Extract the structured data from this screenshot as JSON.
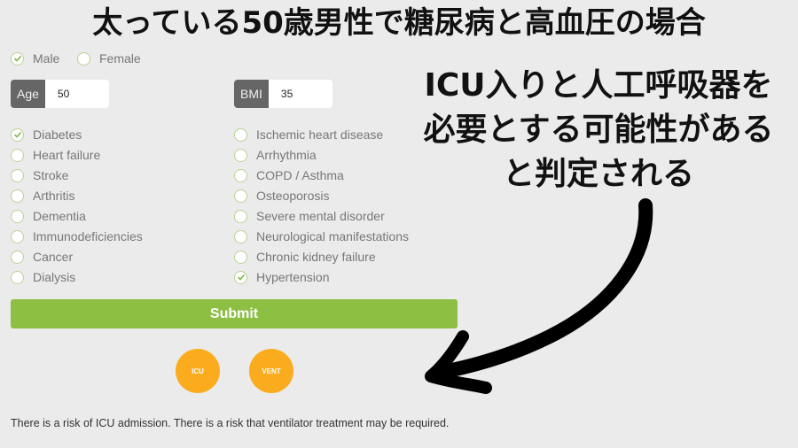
{
  "headline": "太っている50歳男性で糖尿病と高血圧の場合",
  "annotation": {
    "lines": [
      "ICU入りと人工呼吸器を",
      "必要とする可能性がある",
      "と判定される"
    ]
  },
  "sex": {
    "options": [
      {
        "label": "Male",
        "checked": true
      },
      {
        "label": "Female",
        "checked": false
      }
    ]
  },
  "age": {
    "label": "Age",
    "value": "50"
  },
  "bmi": {
    "label": "BMI",
    "value": "35"
  },
  "conditions_left": [
    {
      "label": "Diabetes",
      "checked": true
    },
    {
      "label": "Heart failure",
      "checked": false
    },
    {
      "label": "Stroke",
      "checked": false
    },
    {
      "label": "Arthritis",
      "checked": false
    },
    {
      "label": "Dementia",
      "checked": false
    },
    {
      "label": "Immunodeficiencies",
      "checked": false
    },
    {
      "label": "Cancer",
      "checked": false
    },
    {
      "label": "Dialysis",
      "checked": false
    }
  ],
  "conditions_right": [
    {
      "label": "Ischemic heart disease",
      "checked": false
    },
    {
      "label": "Arrhythmia",
      "checked": false
    },
    {
      "label": "COPD / Asthma",
      "checked": false
    },
    {
      "label": "Osteoporosis",
      "checked": false
    },
    {
      "label": "Severe mental disorder",
      "checked": false
    },
    {
      "label": "Neurological manifestations",
      "checked": false
    },
    {
      "label": "Chronic kidney failure",
      "checked": false
    },
    {
      "label": "Hypertension",
      "checked": true
    }
  ],
  "submit_label": "Submit",
  "badges": [
    {
      "label": "ICU",
      "color": "#fbac1e"
    },
    {
      "label": "VENT",
      "color": "#fbac1e"
    }
  ],
  "result_text": "There is a risk of ICU admission. There is a risk that ventilator treatment may be required.",
  "colors": {
    "accent_green": "#8dbf43",
    "badge_orange": "#fbac1e",
    "background": "#ebebeb"
  }
}
